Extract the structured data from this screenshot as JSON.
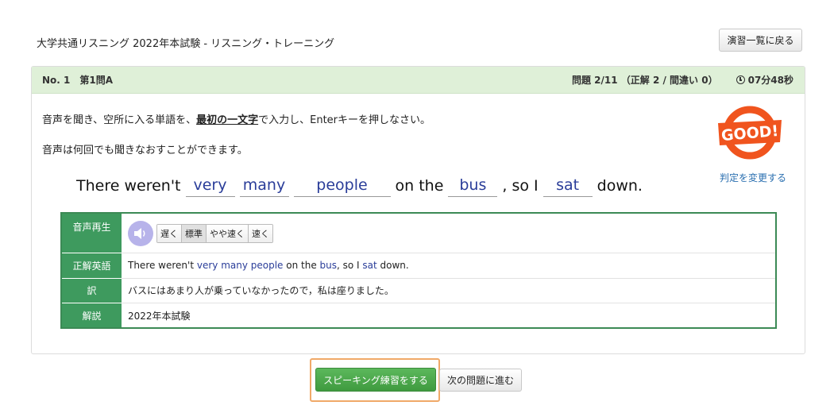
{
  "page": {
    "title": "大学共通リスニング 2022年本試験 - リスニング・トレーニング"
  },
  "toolbar": {
    "back_label": "演習一覧に戻る"
  },
  "header": {
    "question_id": "No. 1　第1問A",
    "progress": "問題 2/11 （正解 2 / 間違い 0）",
    "timer": "07分48秒"
  },
  "instructions": {
    "line1_pre": "音声を聞き、空所に入る単語を、",
    "line1_bold": "最初の一文字",
    "line1_post": "で入力し、Enterキーを押しなさい。",
    "line2": "音声は何回でも聞きなおすことができます。"
  },
  "result": {
    "stamp_text": "GOOD!",
    "change_link": "判定を変更する"
  },
  "sentence": {
    "w1": "There weren't",
    "b1": "very",
    "b2": "many",
    "b3": "people",
    "w2": "on the",
    "b4": "bus",
    "w3": ", so I",
    "b5": "sat",
    "w4": "down."
  },
  "details": {
    "audio_label": "音声再生",
    "speeds": [
      "遅く",
      "標準",
      "やや速く",
      "速く"
    ],
    "selected_speed": "標準",
    "answer_label": "正解英語",
    "answer": {
      "p1": "There weren't ",
      "h1": "very many people",
      "p2": " on the ",
      "h2": "bus",
      "p3": ", so I ",
      "h3": "sat",
      "p4": " down."
    },
    "translation_label": "訳",
    "translation": "バスにはあまり人が乗っていなかったので，私は座りました。",
    "explanation_label": "解説",
    "explanation": "2022年本試験"
  },
  "actions": {
    "speaking_label": "スピーキング練習をする",
    "next_label": "次の問題に進む"
  },
  "colors": {
    "accent_green": "#3e9a5e",
    "header_bg": "#dff0d8",
    "blank_text": "#2a3d99",
    "stamp": "#f0541e",
    "highlight_frame": "#f0a968"
  }
}
